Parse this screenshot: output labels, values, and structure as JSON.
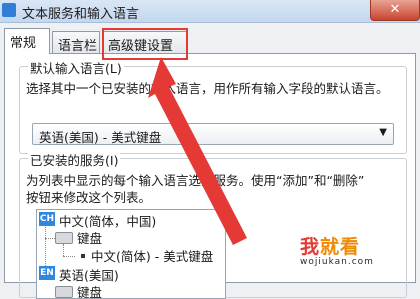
{
  "window": {
    "title": "文本服务和输入语言",
    "close_label": "✕"
  },
  "tabs": [
    {
      "label": "常规",
      "active": true
    },
    {
      "label": "语言栏",
      "active": false
    },
    {
      "label": "高级键设置",
      "active": false,
      "highlighted": true
    }
  ],
  "default_language": {
    "legend": "默认输入语言(L)",
    "description": "选择其中一个已安装的输入语言，用作所有输入字段的默认语言。",
    "selected": "英语(美国) - 美式键盘"
  },
  "installed_services": {
    "legend": "已安装的服务(I)",
    "description_line1": "为列表中显示的每个输入语言选择服务。使用“添加”和“删除”",
    "description_line2": "按钮来修改这个列表。",
    "tree": [
      {
        "badge": "CH",
        "label": "中文(简体，中国)"
      },
      {
        "label": "键盘"
      },
      {
        "label": "中文(简体) - 美式键盘"
      },
      {
        "badge": "EN",
        "label": "英语(美国)"
      },
      {
        "label": "键盘"
      }
    ]
  },
  "annotation": {
    "color": "#e53935"
  },
  "watermark": {
    "text_a": "我",
    "text_b": "就看",
    "url": "wojiukan.com"
  },
  "colors": {
    "accent": "#2e86de",
    "highlight": "#e53935",
    "watermark": "#f08a00"
  }
}
